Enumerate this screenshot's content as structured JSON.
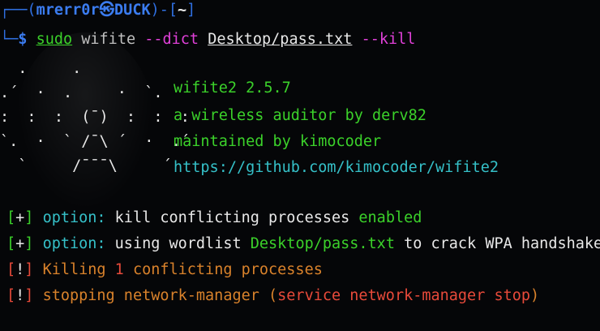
{
  "prompt": {
    "corner_top": "┌──(",
    "user": "mrerr0r",
    "at_symbol": "㉿",
    "host": "DUCK",
    "mid": ")-[",
    "dir": "~",
    "close": "]",
    "corner_bottom": "└─",
    "dollar": "$ "
  },
  "command": {
    "sudo": "sudo",
    "program": "wifite",
    "flag_dict": "--dict",
    "path": "Desktop/pass.txt",
    "flag_kill": "--kill"
  },
  "logo": {
    "line1": "  .     .",
    "line2": ".´  ·  .     ·  `.",
    "line3": ":  :  :  (¯)  :  :  :",
    "line4": "`.  ·  ` /¯\\ ´  ·  .´",
    "line5": "  `     /¯¯¯\\     ´"
  },
  "banner": {
    "title": "wifite2 2.5.7",
    "subtitle": "a wireless auditor by derv82",
    "maintainer": "maintained by kimocoder",
    "url": "https://github.com/kimocoder/wifite2"
  },
  "messages": {
    "m1": {
      "bracket_open": "[",
      "mark": "+",
      "bracket_close": "]",
      "label": "option:",
      "text": "kill conflicting processes",
      "status": "enabled"
    },
    "m2": {
      "bracket_open": "[",
      "mark": "+",
      "bracket_close": "]",
      "label": "option:",
      "text_a": "using wordlist",
      "path": "Desktop/pass.txt",
      "text_b": "to crack WPA handshakes"
    },
    "m3": {
      "bracket_open": "[",
      "mark": "!",
      "bracket_close": "]",
      "text_a": "Killing",
      "count": "1",
      "text_b": "conflicting processes"
    },
    "m4": {
      "bracket_open": "[",
      "mark": "!",
      "bracket_close": "]",
      "text_a": "stopping network-manager",
      "paren_open": "(",
      "cmd": "service network-manager stop",
      "paren_close": ")"
    }
  }
}
